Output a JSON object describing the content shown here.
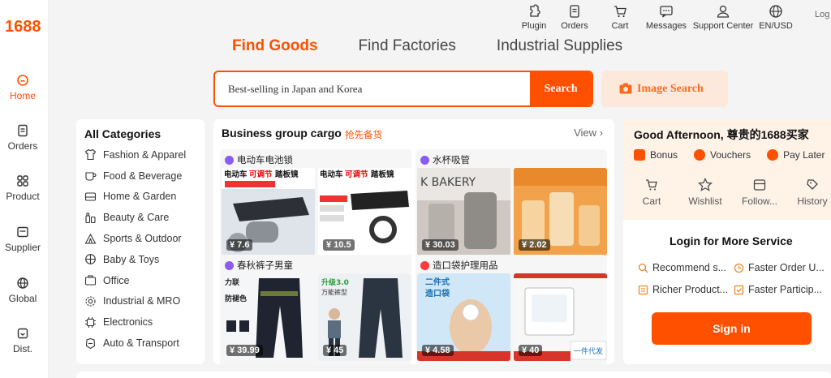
{
  "brand": {
    "logo": "1688",
    "accent": "#ff5000"
  },
  "rail": {
    "items": [
      {
        "label": "Home",
        "icon": "home-icon",
        "active": true
      },
      {
        "label": "Orders",
        "icon": "orders-icon"
      },
      {
        "label": "Product",
        "icon": "product-icon"
      },
      {
        "label": "Supplier",
        "icon": "supplier-icon"
      },
      {
        "label": "Global",
        "icon": "globe-icon"
      },
      {
        "label": "Dist.",
        "icon": "distribution-icon"
      }
    ]
  },
  "topbar": {
    "items": [
      {
        "label": "Plugin",
        "icon": "plugin-icon"
      },
      {
        "label": "Orders",
        "icon": "orders-icon"
      },
      {
        "label": "Cart",
        "icon": "cart-icon"
      },
      {
        "label": "Messages",
        "icon": "message-icon"
      },
      {
        "label": "Support Center",
        "icon": "user-icon"
      },
      {
        "label": "EN/USD",
        "icon": "globe-icon"
      }
    ],
    "login_cut": "Log"
  },
  "tabs": [
    {
      "label": "Find Goods",
      "active": true
    },
    {
      "label": "Find Factories"
    },
    {
      "label": "Industrial Supplies"
    }
  ],
  "search": {
    "value": "Best-selling in Japan and Korea",
    "button": "Search",
    "image_search": "Image Search"
  },
  "categories": {
    "title": "All Categories",
    "items": [
      {
        "label": "Fashion & Apparel",
        "icon": "shirt-icon"
      },
      {
        "label": "Food & Beverage",
        "icon": "cup-icon"
      },
      {
        "label": "Home & Garden",
        "icon": "sofa-icon"
      },
      {
        "label": "Beauty & Care",
        "icon": "bottle-icon"
      },
      {
        "label": "Sports & Outdoor",
        "icon": "tent-icon"
      },
      {
        "label": "Baby & Toys",
        "icon": "ball-icon"
      },
      {
        "label": "Office",
        "icon": "briefcase-icon"
      },
      {
        "label": "Industrial & MRO",
        "icon": "gear-icon"
      },
      {
        "label": "Electronics",
        "icon": "chip-icon"
      },
      {
        "label": "Auto & Transport",
        "icon": "car-icon"
      }
    ]
  },
  "cargo": {
    "title": "Business group cargo",
    "tag": "抢先备货",
    "view": "View",
    "groups": [
      {
        "label": "电动车电池锁",
        "dot": "#8a5cf6",
        "products": [
          {
            "price": "¥ 7.6"
          },
          {
            "price": "¥ 10.5"
          }
        ]
      },
      {
        "label": "水杯吸管",
        "dot": "#8a5cf6",
        "products": [
          {
            "price": "¥ 30.03"
          },
          {
            "price": "¥ 2.02"
          }
        ]
      },
      {
        "label": "春秋裤子男童",
        "dot": "#8a5cf6",
        "products": [
          {
            "price": "¥ 39.99"
          },
          {
            "price": "¥ 45"
          }
        ]
      },
      {
        "label": "造口袋护理用品",
        "dot": "#ff3a3a",
        "products": [
          {
            "price": "¥ 4.58"
          },
          {
            "price": "¥ 40"
          }
        ]
      }
    ]
  },
  "account": {
    "greeting": "Good Afternoon, 尊贵的1688买家",
    "perks": [
      {
        "label": "Bonus",
        "icon": "bonus-icon"
      },
      {
        "label": "Vouchers",
        "icon": "voucher-icon"
      },
      {
        "label": "Pay Later",
        "icon": "pay-later-icon"
      }
    ],
    "quick": [
      {
        "label": "Cart",
        "icon": "cart-icon"
      },
      {
        "label": "Wishlist",
        "icon": "star-icon"
      },
      {
        "label": "Follow...",
        "icon": "store-icon"
      },
      {
        "label": "History",
        "icon": "history-icon"
      }
    ],
    "login_title": "Login for More Service",
    "services": [
      {
        "label": "Recommend s...",
        "icon": "search-icon"
      },
      {
        "label": "Faster Order U...",
        "icon": "clock-icon"
      },
      {
        "label": "Richer Product...",
        "icon": "doc-icon"
      },
      {
        "label": "Faster Particip...",
        "icon": "check-icon"
      }
    ],
    "signin": "Sign in"
  }
}
